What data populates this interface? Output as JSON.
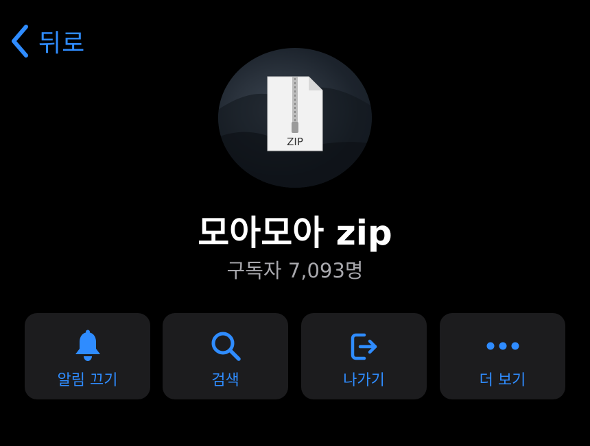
{
  "nav": {
    "back_label": "뒤로"
  },
  "channel": {
    "name": "모아모아 zip",
    "subscribers": "구독자 7,093명",
    "avatar_badge": "ZIP"
  },
  "actions": [
    {
      "label": "알림 끄기",
      "icon": "bell-icon"
    },
    {
      "label": "검색",
      "icon": "search-icon"
    },
    {
      "label": "나가기",
      "icon": "exit-icon"
    },
    {
      "label": "더 보기",
      "icon": "more-icon"
    }
  ],
  "colors": {
    "accent": "#2f8cff",
    "background": "#000000",
    "button_bg": "#1c1c1e",
    "secondary_text": "#a8a8ad"
  }
}
